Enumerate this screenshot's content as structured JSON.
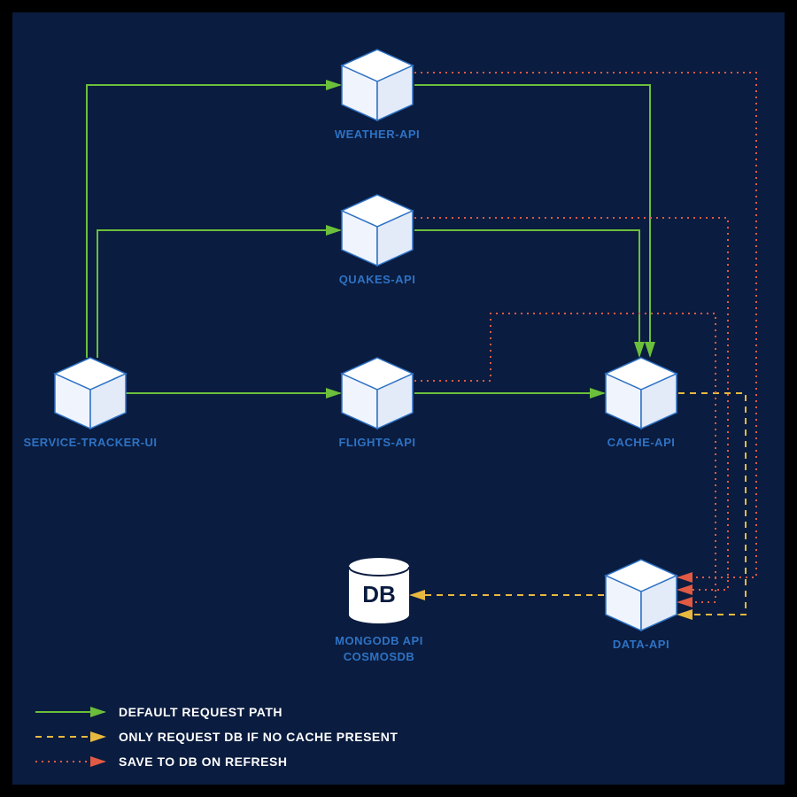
{
  "nodes": {
    "service_tracker_ui": {
      "label": "SERVICE-TRACKER-UI"
    },
    "weather_api": {
      "label": "WEATHER-API"
    },
    "quakes_api": {
      "label": "QUAKES-API"
    },
    "flights_api": {
      "label": "FLIGHTS-API"
    },
    "cache_api": {
      "label": "CACHE-API"
    },
    "data_api": {
      "label": "DATA-API"
    },
    "mongodb": {
      "label_line1": "MONGODB API",
      "label_line2": "COSMOSDB",
      "glyph": "DB"
    }
  },
  "legend": {
    "default_path": "DEFAULT REQUEST PATH",
    "cache_miss": "ONLY REQUEST DB IF NO CACHE PRESENT",
    "save_refresh": "SAVE TO DB ON REFRESH"
  },
  "colors": {
    "background": "#0a1c3f",
    "accent": "#2e72c4",
    "green": "#6bbf3b",
    "yellow": "#e8b93f",
    "red": "#e05a44",
    "white": "#ffffff"
  },
  "edges": [
    {
      "from": "service_tracker_ui",
      "to": "weather_api",
      "kind": "default"
    },
    {
      "from": "service_tracker_ui",
      "to": "quakes_api",
      "kind": "default"
    },
    {
      "from": "service_tracker_ui",
      "to": "flights_api",
      "kind": "default"
    },
    {
      "from": "weather_api",
      "to": "cache_api",
      "kind": "default"
    },
    {
      "from": "quakes_api",
      "to": "cache_api",
      "kind": "default"
    },
    {
      "from": "flights_api",
      "to": "cache_api",
      "kind": "default"
    },
    {
      "from": "cache_api",
      "to": "data_api",
      "kind": "cache_miss"
    },
    {
      "from": "data_api",
      "to": "mongodb",
      "kind": "cache_miss"
    },
    {
      "from": "weather_api",
      "to": "data_api",
      "kind": "save_refresh"
    },
    {
      "from": "quakes_api",
      "to": "data_api",
      "kind": "save_refresh"
    },
    {
      "from": "flights_api",
      "to": "data_api",
      "kind": "save_refresh"
    }
  ]
}
